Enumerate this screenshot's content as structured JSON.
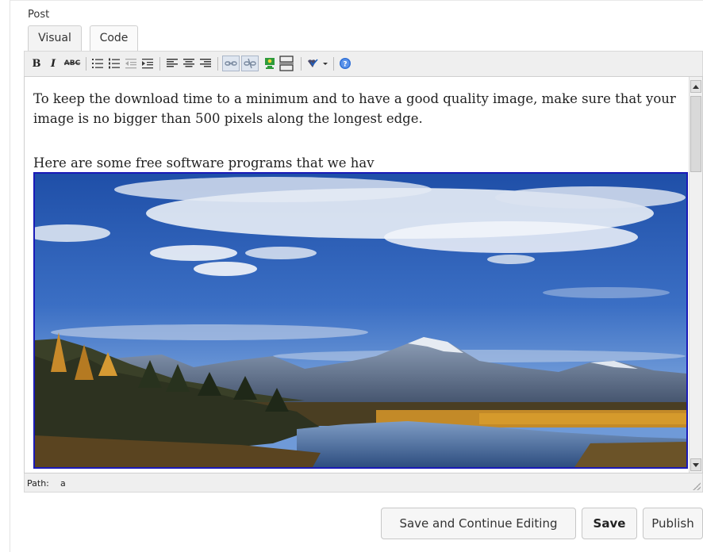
{
  "post": {
    "label": "Post"
  },
  "tabs": [
    {
      "label": "Visual"
    },
    {
      "label": "Code"
    }
  ],
  "toolbar": {
    "bold": "B",
    "italic": "I",
    "strikethrough": "ABC",
    "buttons": [
      "bold-icon",
      "italic-icon",
      "strikethrough-icon",
      "bulleted-list-icon",
      "numbered-list-icon",
      "outdent-icon",
      "indent-icon",
      "align-left-icon",
      "align-center-icon",
      "align-right-icon",
      "insert-link-icon",
      "unlink-icon",
      "insert-image-icon",
      "more-tag-icon",
      "spellcheck-icon",
      "help-icon"
    ]
  },
  "editor": {
    "paragraph1": "To keep the download time to a minimum and to have a good quality image, make sure that your image is no bigger than 500 pixels along the longest edge.",
    "paragraph2": "Here are some free software programs that we hav"
  },
  "pathbar": {
    "label": "Path:",
    "value": "a"
  },
  "buttons": {
    "save_continue": "Save and Continue Editing",
    "save": "Save",
    "publish": "Publish"
  },
  "colors": {
    "image_selection_border": "#1a1ab8",
    "help_icon": "#2f6fd6",
    "image_icon": "#2e9b3b"
  }
}
